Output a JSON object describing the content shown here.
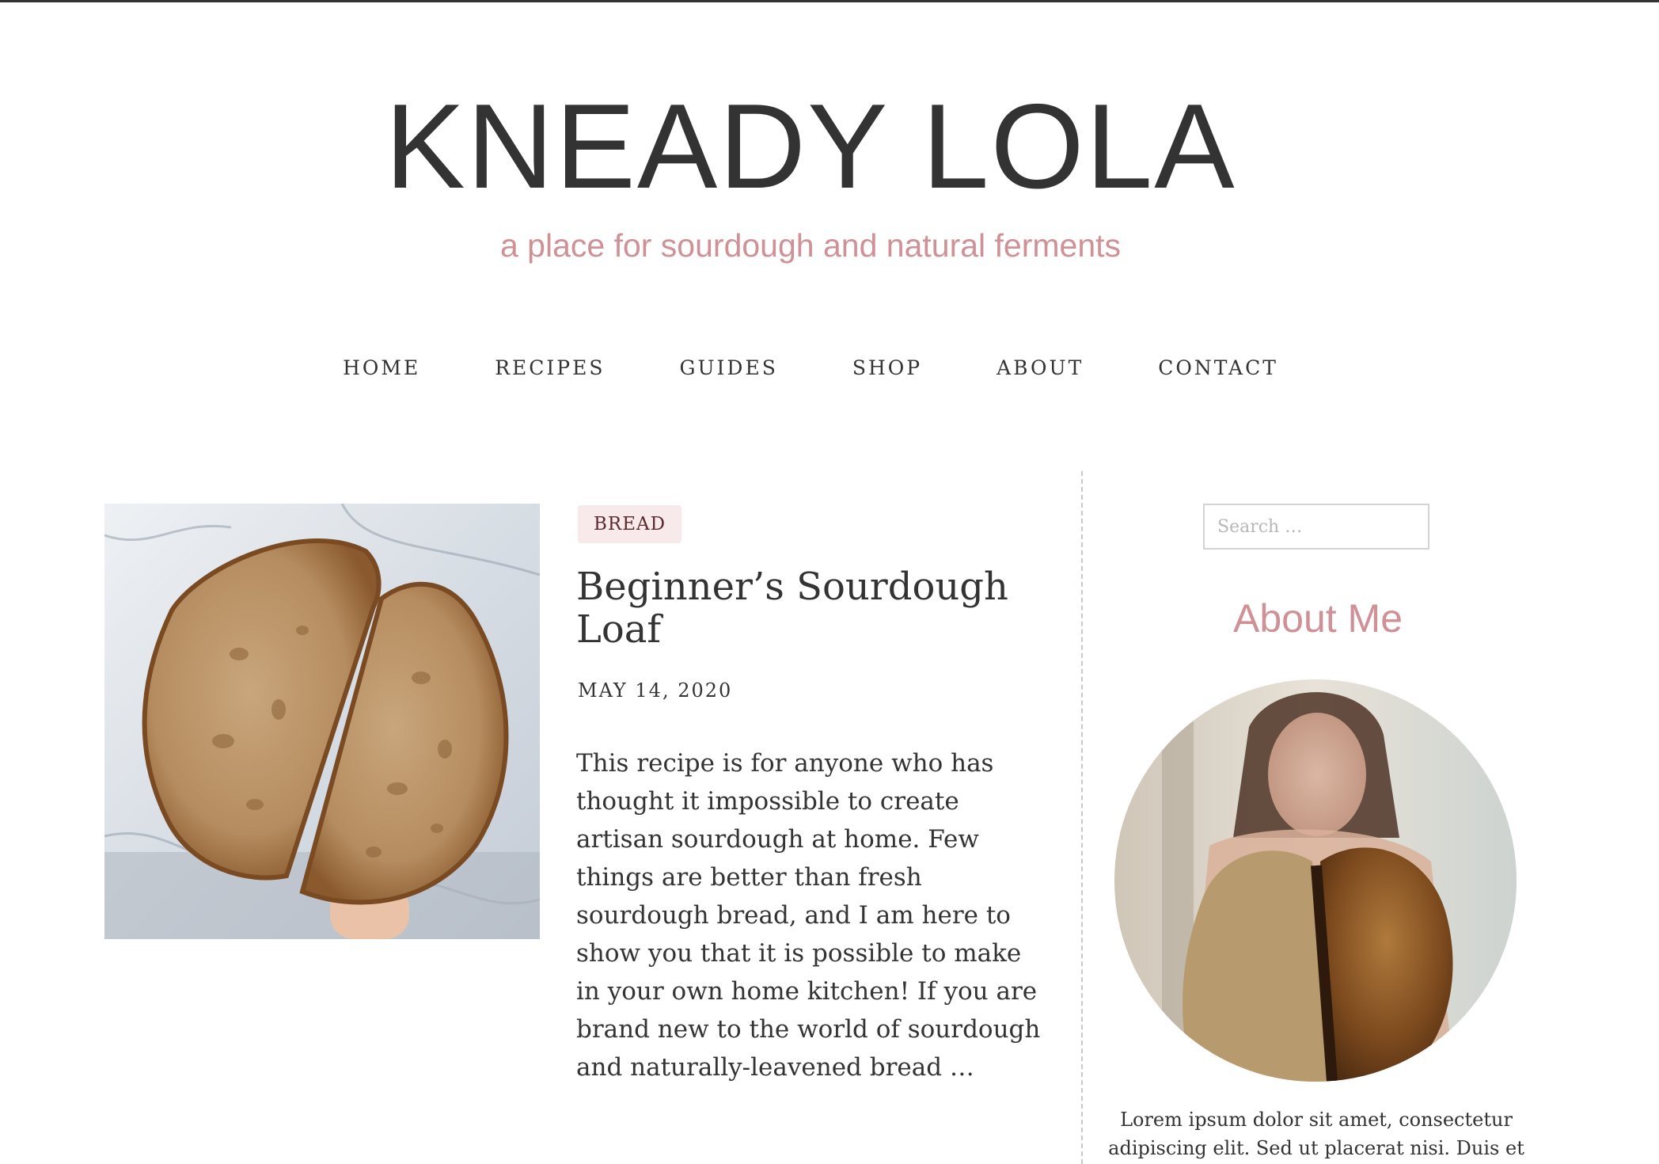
{
  "site": {
    "title": "KNEADY LOLA",
    "tagline": "a place for sourdough and natural ferments"
  },
  "nav": {
    "items": [
      "HOME",
      "RECIPES",
      "GUIDES",
      "SHOP",
      "ABOUT",
      "CONTACT"
    ]
  },
  "post": {
    "category": "BREAD",
    "title": "Beginner’s Sourdough Loaf",
    "date": "MAY 14, 2020",
    "excerpt": "This recipe is for anyone who has thought it impossible to create artisan sourdough at home. Few things are better than fresh sourdough bread, and I am here to show you that it is possible to make in your own home kitchen! If you are brand new to the world of sourdough and naturally-leavened bread …"
  },
  "sidebar": {
    "search": {
      "placeholder": "Search …"
    },
    "about": {
      "title": "About Me",
      "text": "Lorem ipsum dolor sit amet, consectetur adipiscing elit. Sed ut placerat nisi. Duis et"
    }
  },
  "colors": {
    "accent": "#cf9196",
    "text": "#333333",
    "category_bg": "#f8eaeb",
    "category_text": "#5b2a2e",
    "divider": "#c8c8c8"
  },
  "icons": {
    "post_image": "sourdough-loaf-halves-photo",
    "about_photo": "baker-holding-loaf-photo"
  }
}
